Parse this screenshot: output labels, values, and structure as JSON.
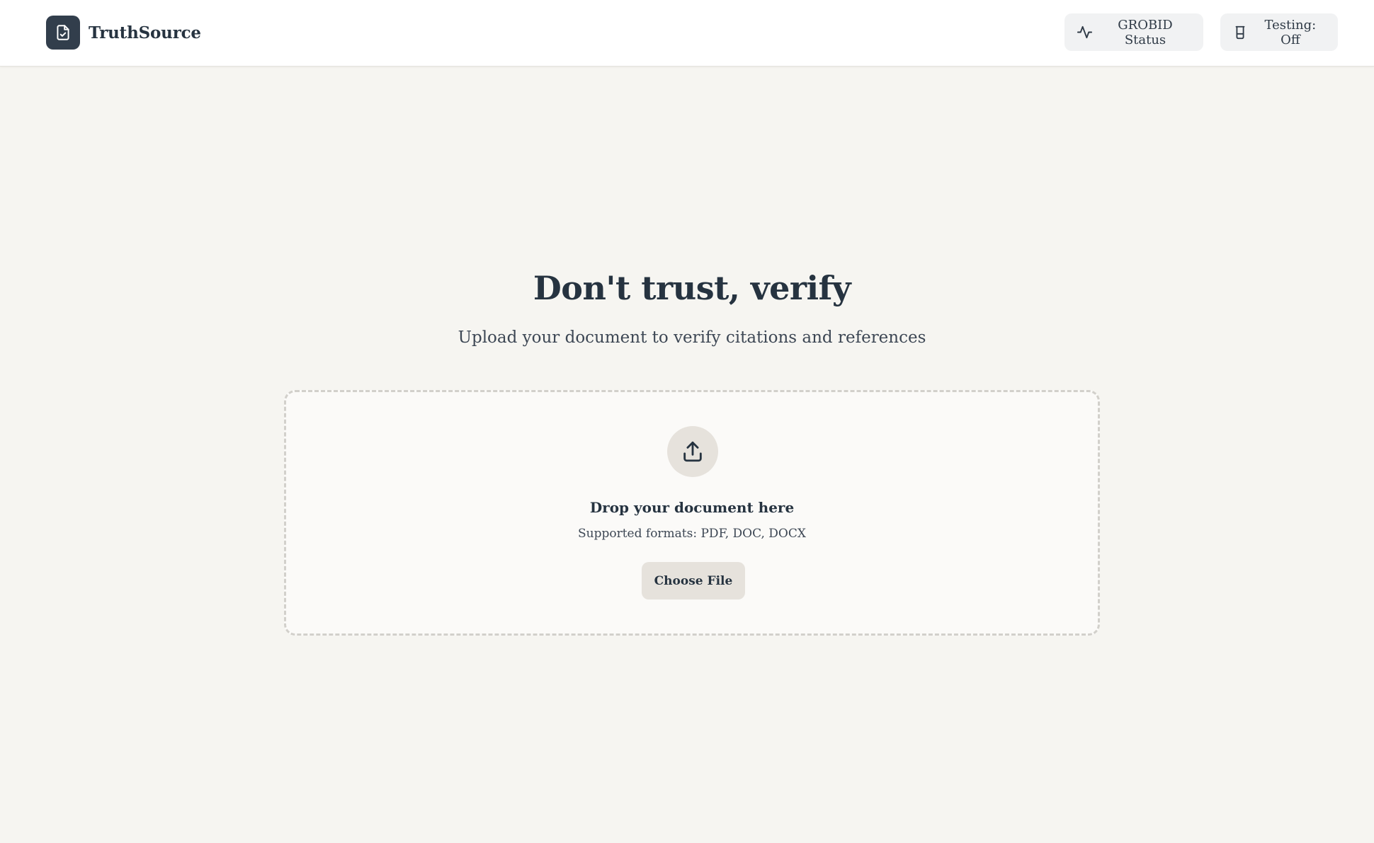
{
  "header": {
    "brand_name": "TruthSource",
    "brand_icon": "file-check-icon",
    "grobid_label": "GROBID Status",
    "grobid_icon": "activity-icon",
    "testing_label": "Testing: Off",
    "testing_icon": "beaker-icon"
  },
  "hero": {
    "title": "Don't trust, verify",
    "subtitle": "Upload your document to verify citations and references"
  },
  "upload": {
    "icon": "upload-icon",
    "title": "Drop your document here",
    "formats": "Supported formats: PDF, DOC, DOCX",
    "button_label": "Choose File"
  },
  "colors": {
    "background": "#f6f5f1",
    "header_bg": "#ffffff",
    "brand_logo_bg": "#323e4c",
    "text_primary": "#263340",
    "pill_bg": "#f1f2f3",
    "accent_muted": "#e6e2dc",
    "dropzone_border": "#d2d0cb"
  }
}
